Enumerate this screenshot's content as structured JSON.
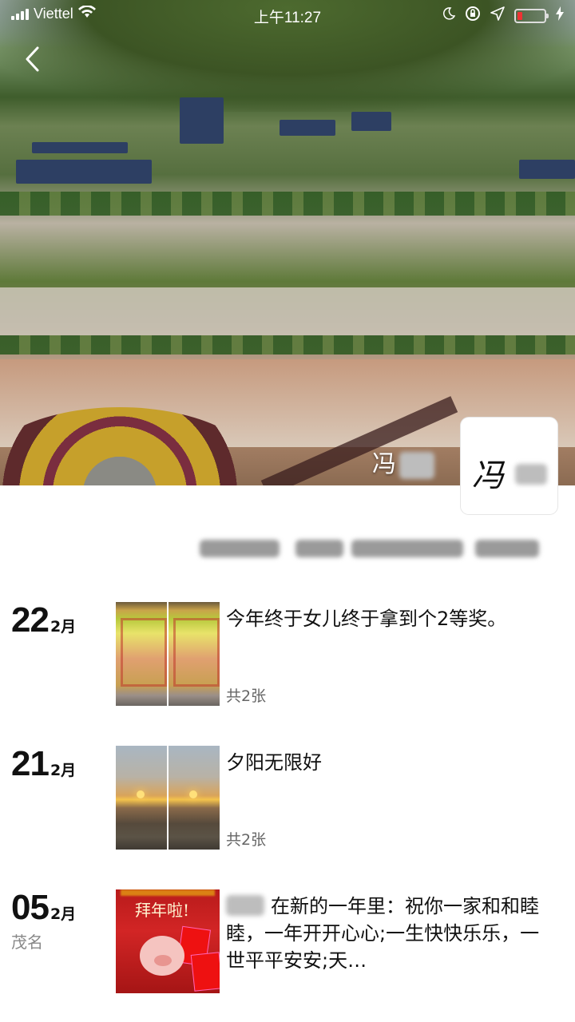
{
  "status_bar": {
    "carrier": "Viettel",
    "time": "上午11:27"
  },
  "cover": {
    "name_visible": "冯",
    "avatar_signature": "冯"
  },
  "posts": [
    {
      "day": "22",
      "month": "2月",
      "location": "",
      "text": "今年终于女儿终于拿到个2等奖。",
      "photo_count_label": "共2张",
      "thumb_style": "certificate"
    },
    {
      "day": "21",
      "month": "2月",
      "location": "",
      "text": "夕阳无限好",
      "photo_count_label": "共2张",
      "thumb_style": "sunset"
    },
    {
      "day": "05",
      "month": "2月",
      "location": "茂名",
      "text": "在新的一年里：祝你一家和和睦睦，一年开开心心;一生快快乐乐，一世平平安安;天…",
      "photo_count_label": "",
      "thumb_style": "new-year",
      "thumb_caption": "拜年啦!"
    }
  ],
  "icons": {
    "back": "chevron-left-icon",
    "wifi": "wifi-icon",
    "moon": "moon-icon",
    "lock": "rotation-lock-icon",
    "location": "location-arrow-icon",
    "battery": "battery-icon",
    "charging": "charging-bolt-icon"
  },
  "colors": {
    "battery_low": "#e33333",
    "text_primary": "#111111",
    "text_secondary": "#666666"
  }
}
